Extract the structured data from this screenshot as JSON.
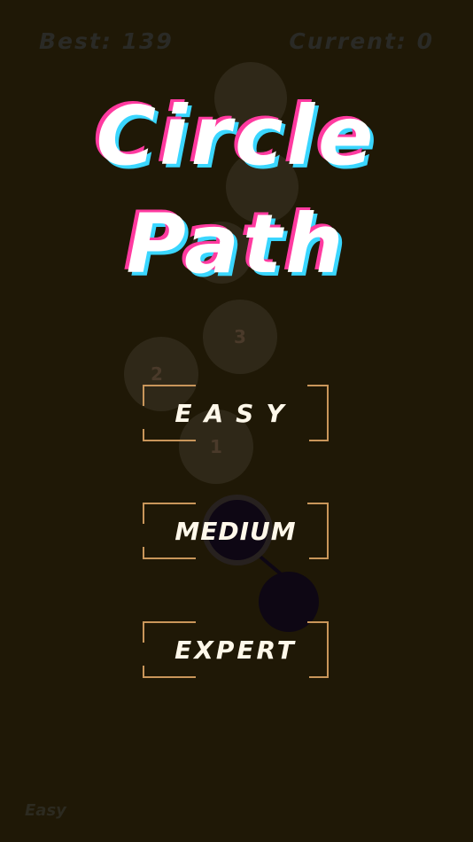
{
  "hud": {
    "best_label": "Best: 139",
    "current_label": "Current: 0"
  },
  "title": {
    "line1": "Circle",
    "line2": "Path"
  },
  "path_numbers": {
    "n3": "3",
    "n2": "2",
    "n1": "1"
  },
  "menu": {
    "easy": "EASY",
    "medium": "MEDIUM",
    "expert": "EXPERT"
  },
  "footer": {
    "mode": "Easy"
  },
  "colors": {
    "background": "#1f1806",
    "bracket": "#c9965a",
    "title_pink": "#ff3aa0",
    "title_cyan": "#3ad6ff"
  }
}
